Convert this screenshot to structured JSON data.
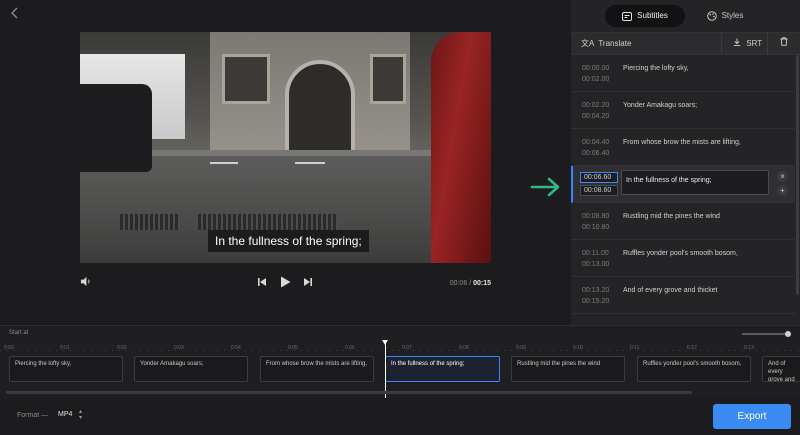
{
  "video": {
    "subtitle": "In the fullness of the spring;",
    "current_time": "00:06",
    "separator": "/",
    "duration": "00:15"
  },
  "panel": {
    "tabs": [
      {
        "label": "Subtitles",
        "icon": "subtitles-icon",
        "active": true
      },
      {
        "label": "Styles",
        "icon": "palette-icon",
        "active": false
      }
    ],
    "translate_label": "Translate",
    "srt_label": "SRT",
    "subtitles": [
      {
        "start": "00:00.00",
        "end": "00:02.00",
        "text": "Piercing the lofty sky,"
      },
      {
        "start": "00:02.20",
        "end": "00:04.20",
        "text": "Yonder Amakagu soars;"
      },
      {
        "start": "00:04.40",
        "end": "00:06.40",
        "text": "From whose brow the mists are lifting,"
      },
      {
        "start": "00:06.60",
        "end": "00:08.60",
        "text": "In the fullness of the spring;",
        "active": true
      },
      {
        "start": "00:08.80",
        "end": "00:10.80",
        "text": "Rustling mid the pines the wind"
      },
      {
        "start": "00:11.00",
        "end": "00:13.00",
        "text": "Ruffles yonder pool's smooth bosom,"
      },
      {
        "start": "00:13.20",
        "end": "00:15.20",
        "text": "And of every grove and thicket"
      }
    ]
  },
  "timeline": {
    "start_label": "Start at",
    "ticks": [
      "0:00",
      "0:01",
      "0:02",
      "0:03",
      "0:04",
      "0:05",
      "0:06",
      "0:07",
      "0:08",
      "0:09",
      "0:10",
      "0:11",
      "0:12",
      "0:13"
    ],
    "clips": [
      {
        "text": "Piercing the lofty sky,"
      },
      {
        "text": "Yonder Amakagu soars;"
      },
      {
        "text": "From whose brow the mists are lifting,"
      },
      {
        "text": "In the fullness of the spring;",
        "active": true
      },
      {
        "text": "Rustling mid the pines the wind"
      },
      {
        "text": "Ruffles yonder pool's smooth bosom,"
      },
      {
        "text": "And of every grove and thicket"
      }
    ]
  },
  "footer": {
    "format_label": "Format —",
    "format_value": "MP4",
    "export_label": "Export"
  },
  "colors": {
    "accent": "#3b8bf5",
    "arrow": "#2fb98a"
  }
}
